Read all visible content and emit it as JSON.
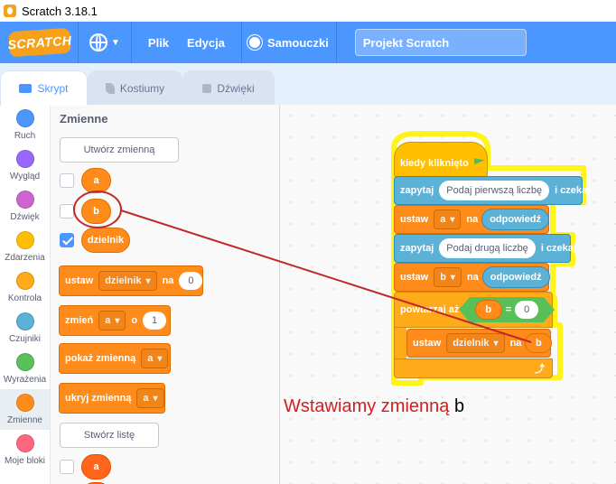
{
  "window": {
    "title": "Scratch 3.18.1"
  },
  "menubar": {
    "logo": "SCRATCH",
    "file": "Plik",
    "edit": "Edycja",
    "tutorials": "Samouczki",
    "project_title": "Projekt Scratch"
  },
  "tabs": {
    "code": "Skrypt",
    "costumes": "Kostiumy",
    "sounds": "Dźwięki"
  },
  "categories": [
    {
      "label": "Ruch",
      "color": "#4c97ff"
    },
    {
      "label": "Wygląd",
      "color": "#9966ff"
    },
    {
      "label": "Dźwięk",
      "color": "#cf63cf"
    },
    {
      "label": "Zdarzenia",
      "color": "#ffbf00"
    },
    {
      "label": "Kontrola",
      "color": "#ffab19"
    },
    {
      "label": "Czujniki",
      "color": "#5cb1d6"
    },
    {
      "label": "Wyrażenia",
      "color": "#59c059"
    },
    {
      "label": "Zmienne",
      "color": "#ff8c1a"
    },
    {
      "label": "Moje bloki",
      "color": "#ff6680"
    }
  ],
  "palette": {
    "heading": "Zmienne",
    "make_variable": "Utwórz zmienną",
    "variables": [
      "a",
      "b",
      "dzielnik"
    ],
    "set_block": {
      "label": "ustaw",
      "var": "dzielnik",
      "to": "na",
      "value": "0"
    },
    "change_block": {
      "label": "zmień",
      "var": "a",
      "by": "o",
      "value": "1"
    },
    "show_block": {
      "label": "pokaż zmienną",
      "var": "a"
    },
    "hide_block": {
      "label": "ukryj zmienną",
      "var": "a"
    },
    "make_list": "Stwórz listę",
    "list_item": "a"
  },
  "script": {
    "hat": "kiedy kliknięto",
    "ask1": {
      "label": "zapytaj",
      "text": "Podaj pierwszą liczbę",
      "suffix": "i czekaj"
    },
    "set1": {
      "label": "ustaw",
      "var": "a",
      "to": "na",
      "value": "odpowiedź"
    },
    "ask2": {
      "label": "zapytaj",
      "text": "Podaj drugą liczbę",
      "suffix": "i czekaj"
    },
    "set2": {
      "label": "ustaw",
      "var": "b",
      "to": "na",
      "value": "odpowiedź"
    },
    "repeat": {
      "label": "powtarzaj aż",
      "left": "b",
      "op": "=",
      "right": "0"
    },
    "inner_set": {
      "label": "ustaw",
      "var": "dzielnik",
      "to": "na",
      "value": "b"
    },
    "loop_arrow": "⤴"
  },
  "annotation": {
    "text": "Wstawiamy zmienną",
    "var": "b",
    "color": "#d01f1f"
  }
}
